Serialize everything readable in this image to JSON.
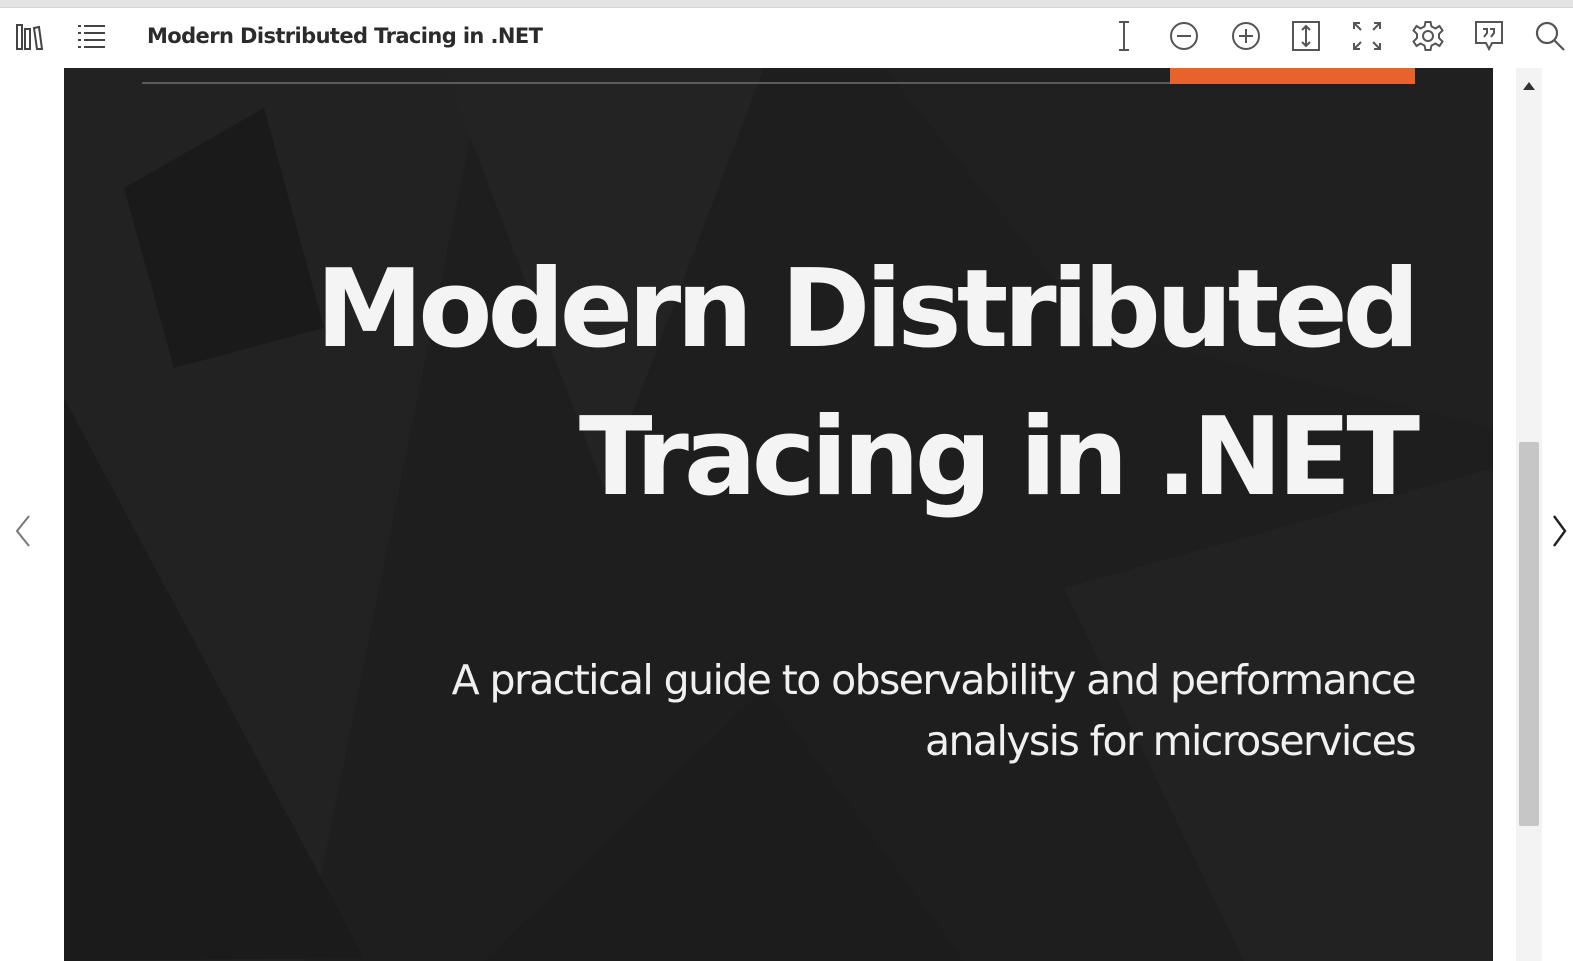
{
  "toolbar": {
    "title": "Modern Distributed Tracing in .NET",
    "left_icons": [
      "library-icon",
      "contents-icon"
    ],
    "right_icons": [
      "text-select-icon",
      "zoom-out-icon",
      "zoom-in-icon",
      "fit-height-icon",
      "fullscreen-icon",
      "settings-icon",
      "notes-icon",
      "search-icon"
    ]
  },
  "navigation": {
    "previous_icon": "chevron-left-icon",
    "next_icon": "chevron-right-icon"
  },
  "page": {
    "title_lines": [
      "Modern Distributed",
      "Tracing in .NET"
    ],
    "subtitle_lines": [
      "A practical guide to observability and performance",
      "analysis for microservices"
    ]
  },
  "scrollbar": {
    "up_icon": "scroll-up-arrow-icon",
    "position_fraction": 0.42
  },
  "colors": {
    "page_background": "#1e1e1e",
    "accent": "#e8632c",
    "cover_text": "#f4f4f4",
    "toolbar_text": "#2b2b2b"
  }
}
